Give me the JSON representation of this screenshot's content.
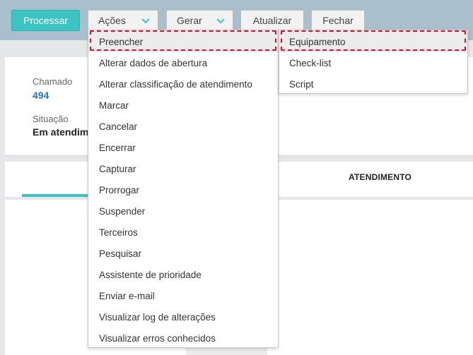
{
  "toolbar": {
    "processar_label": "Processar",
    "acoes_label": "Ações",
    "gerar_label": "Gerar",
    "atualizar_label": "Atualizar",
    "fechar_label": "Fechar",
    "chevron_icon": "chevron-down-icon",
    "chevron_color": "#3cc3c3"
  },
  "details": {
    "chamado_label": "Chamado",
    "chamado_value": "494",
    "situacao_label": "Situação",
    "situacao_value": "Em atendime"
  },
  "tabs": {
    "atendimento_label": "ATENDIMENTO"
  },
  "acoes_menu": {
    "items": [
      "Preencher",
      "Alterar dados de abertura",
      "Alterar classificação de atendimento",
      "Marcar",
      "Cancelar",
      "Encerrar",
      "Capturar",
      "Prorrogar",
      "Suspender",
      "Terceiros",
      "Pesquisar",
      "Assistente de prioridade",
      "Enviar e-mail",
      "Visualizar log de alterações",
      "Visualizar erros conhecidos"
    ]
  },
  "preencher_submenu": {
    "items": [
      "Equipamento",
      "Check-list",
      "Script"
    ]
  },
  "colors": {
    "accent": "#3cc3c3",
    "topbar": "#a9c0cc",
    "link": "#2a74b8",
    "highlight": "#e0102a"
  }
}
